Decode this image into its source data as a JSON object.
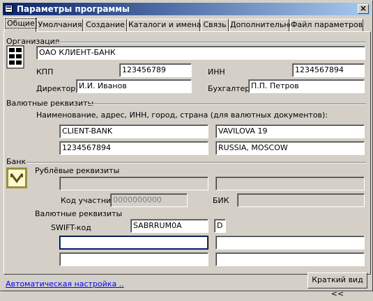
{
  "window": {
    "title": "Параметры программы"
  },
  "tabs": [
    {
      "label": "Общие"
    },
    {
      "label": "Умолчания"
    },
    {
      "label": "Создание"
    },
    {
      "label": "Каталоги и имена"
    },
    {
      "label": "Связь"
    },
    {
      "label": "Дополнительно"
    },
    {
      "label": "Файл параметров"
    }
  ],
  "org": {
    "section": "Организация",
    "name": "ОАО КЛИЕНТ-БАНК",
    "kpp_label": "КПП",
    "kpp": "123456789",
    "inn_label": "ИНН",
    "inn": "1234567894",
    "director_label": "Директор",
    "director": "И.И. Иванов",
    "accountant_label": "Бухгалтер",
    "accountant": "П.П. Петров"
  },
  "currency": {
    "section": "Валютные реквизиты",
    "hint": "Наименование, адрес, ИНН, город, страна (для валютных документов):",
    "f1": "CLIENT-BANK",
    "f2": "VAVILOVA 19",
    "f3": "1234567894",
    "f4": "RUSSIA, MOSCOW"
  },
  "bank": {
    "section": "Банк",
    "rub_label": "Рублёвые реквизиты",
    "rub1": "",
    "rub2": "",
    "member_code_label": "Код участника",
    "member_code": "0000000000",
    "bik_label": "БИК",
    "bik": "",
    "cur_label": "Валютные реквизиты",
    "swift_label": "SWIFT-код",
    "swift": "SABRRUM0A",
    "swift_suffix": "D",
    "c1": "",
    "c2": "",
    "c3": "",
    "c4": ""
  },
  "footer": {
    "auto_link": "Автоматическая настройка ..",
    "short_view_button": "Краткий вид <<"
  }
}
